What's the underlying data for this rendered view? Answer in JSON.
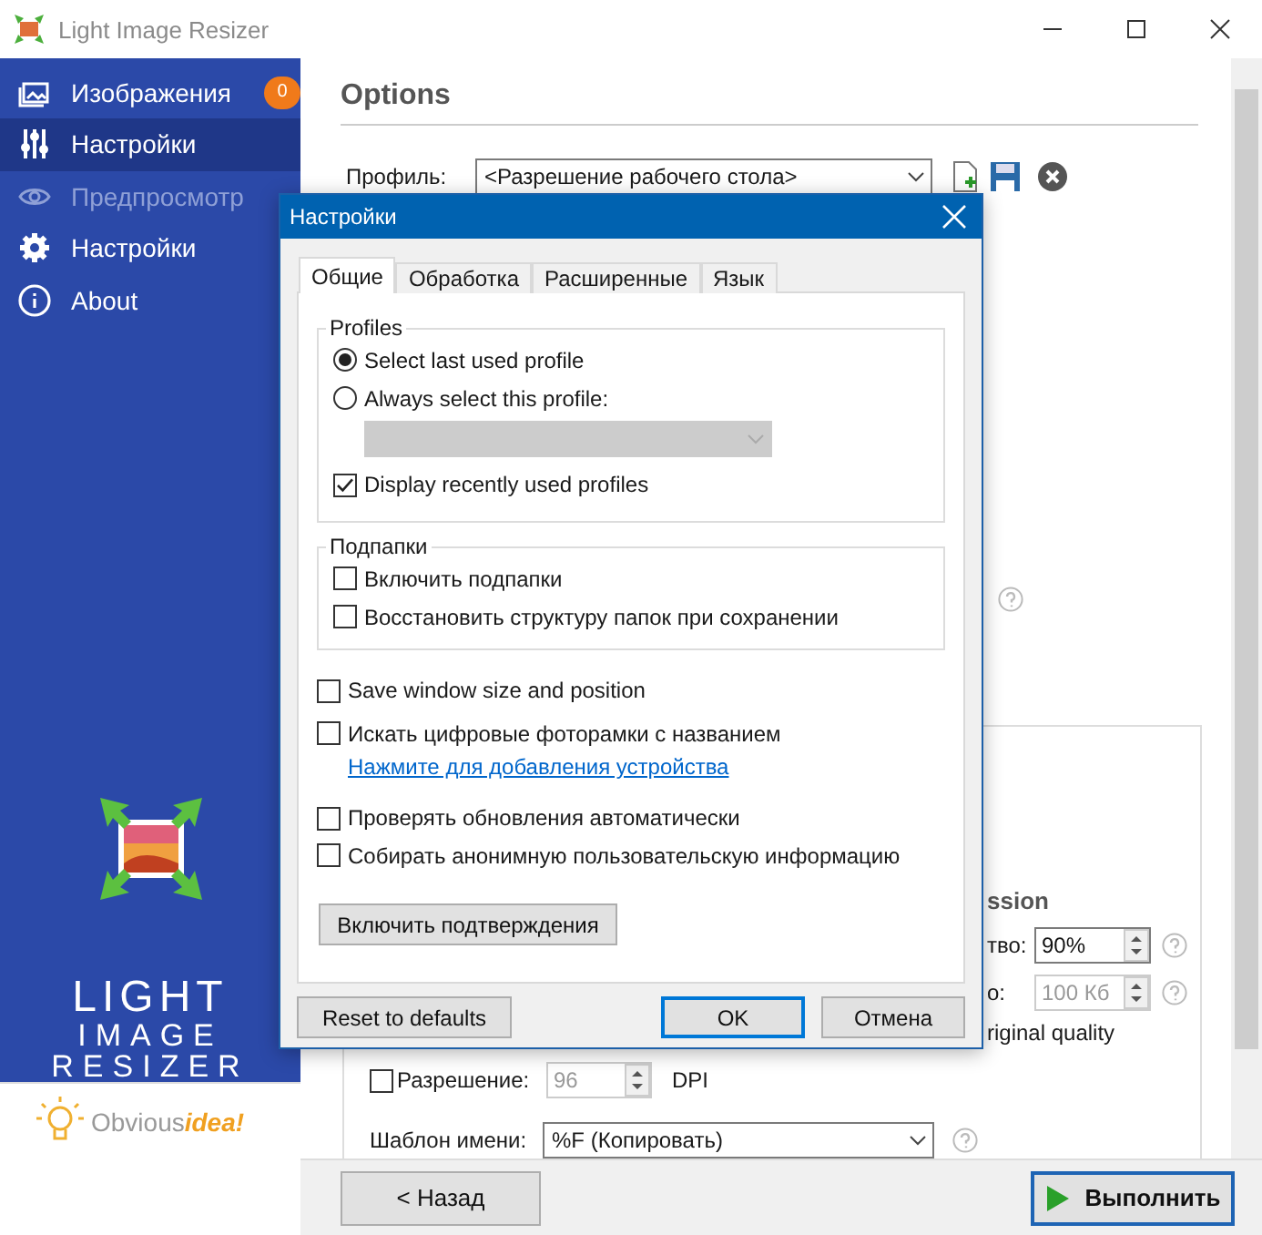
{
  "window": {
    "title": "Light Image Resizer"
  },
  "sidebar": {
    "items": [
      {
        "kind": "images",
        "label": "Изображения",
        "selected": false,
        "disabled": false,
        "badge": "0"
      },
      {
        "kind": "sliders",
        "label": "Настройки",
        "selected": true,
        "disabled": false
      },
      {
        "kind": "eye",
        "label": "Предпросмотр",
        "selected": false,
        "disabled": true
      },
      {
        "kind": "gear",
        "label": "Настройки",
        "selected": false,
        "disabled": false
      },
      {
        "kind": "info",
        "label": "About",
        "selected": false,
        "disabled": false
      }
    ],
    "logo_lines": [
      "LIGHT",
      "IMAGE",
      "RESIZER"
    ],
    "brand": {
      "first": "Obvious",
      "second": "idea!"
    }
  },
  "main": {
    "heading": "Options",
    "profile": {
      "label": "Профиль:",
      "value": "<Разрешение рабочего стола>"
    },
    "panel": {
      "section_title": "ssion",
      "quality": {
        "label": "тво:",
        "value": "90%",
        "disabled": false
      },
      "size": {
        "label": "о:",
        "value": "100 Кб",
        "disabled": true
      },
      "note": "riginal quality",
      "resolution": {
        "label": "Разрешение:",
        "checked": false,
        "value": "96",
        "unit": "DPI",
        "disabled": true
      },
      "name_template": {
        "label": "Шаблон имени:",
        "value": "%F (Копировать)"
      }
    }
  },
  "dialog": {
    "title": "Настройки",
    "tabs": [
      {
        "label": "Общие",
        "selected": true
      },
      {
        "label": "Обработка",
        "selected": false
      },
      {
        "label": "Расширенные",
        "selected": false
      },
      {
        "label": "Язык",
        "selected": false
      }
    ],
    "profiles": {
      "title": "Profiles",
      "radios": [
        {
          "label": "Select last used profile",
          "selected": true
        },
        {
          "label": "Always select this profile:",
          "selected": false
        }
      ],
      "select_disabled": true,
      "checkbox": {
        "label": "Display recently used profiles",
        "checked": true
      }
    },
    "subfolders": {
      "title": "Подпапки",
      "checkboxes": [
        {
          "label": "Включить подпапки",
          "checked": false
        },
        {
          "label": "Восстановить структуру папок при сохранении",
          "checked": false
        }
      ]
    },
    "options": [
      {
        "kind": "checkbox",
        "label": "Save window size and position",
        "checked": false
      },
      {
        "kind": "checkbox",
        "label": "Искать цифровые фоторамки с названием",
        "checked": false
      },
      {
        "kind": "link",
        "label": "Нажмите для добавления устройства"
      },
      {
        "kind": "checkbox",
        "label": "Проверять обновления автоматически",
        "checked": false
      },
      {
        "kind": "checkbox",
        "label": "Собирать анонимную пользовательскую информацию",
        "checked": false
      }
    ],
    "confirm_button": "Включить подтверждения",
    "buttons": [
      {
        "label": "Reset to defaults",
        "default": false
      },
      {
        "label": "OK",
        "default": true
      },
      {
        "label": "Отмена",
        "default": false
      }
    ]
  },
  "footer": {
    "back": "< Назад",
    "run": "Выполнить"
  }
}
